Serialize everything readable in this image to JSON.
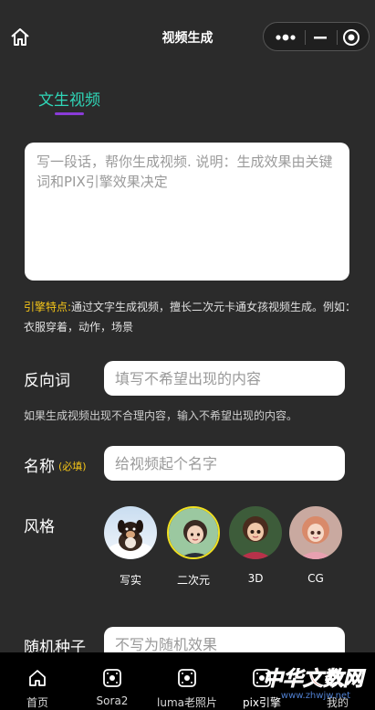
{
  "nav": {
    "title": "视频生成"
  },
  "tabs": [
    {
      "label": "文生视频"
    }
  ],
  "prompt": {
    "placeholder": "写一段话，帮你生成视频. 说明：生成效果由关键词和PIX引擎效果决定"
  },
  "feature": {
    "label": "引擎特点:",
    "text": "通过文字生成视频，擅长二次元卡通女孩视频生成。例如：衣服穿着，动作，场景"
  },
  "negative": {
    "label": "反向词",
    "placeholder": "填写不希望出现的内容",
    "hint": "如果生成视频出现不合理内容，输入不希望出现的内容。"
  },
  "name": {
    "label": "名称",
    "required": "(必填)",
    "placeholder": "给视频起个名字"
  },
  "style": {
    "label": "风格",
    "options": [
      {
        "label": "写实"
      },
      {
        "label": "二次元"
      },
      {
        "label": "3D"
      },
      {
        "label": "CG"
      }
    ],
    "selected": "二次元"
  },
  "seed": {
    "label": "随机种子",
    "placeholder": "不写为随机效果"
  },
  "tabbar": [
    {
      "label": "首页",
      "icon": "home-icon"
    },
    {
      "label": "Sora2",
      "icon": "video-icon"
    },
    {
      "label": "luma老照片",
      "icon": "video-icon"
    },
    {
      "label": "pix引擎",
      "icon": "video-icon"
    },
    {
      "label": "我的",
      "icon": "user-icon"
    }
  ],
  "watermark": {
    "text": "中华文数网",
    "url": "www.zhwjw.net"
  },
  "colors": {
    "accent": "#2fd6b7",
    "tab_underline": "#8a3bd8",
    "highlight": "#f5c518",
    "background": "#2b2b2b"
  }
}
